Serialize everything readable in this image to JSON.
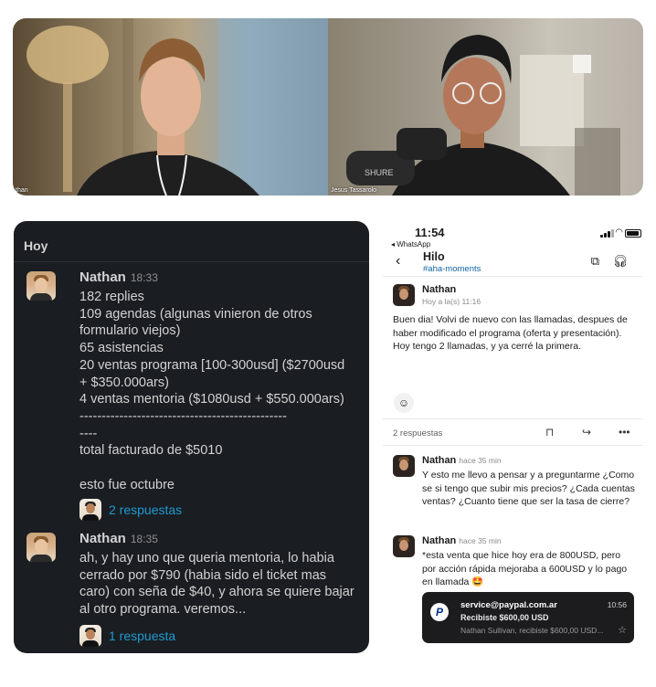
{
  "video": {
    "left_name": "than",
    "right_name": "Jesus Tassarolo"
  },
  "slack": {
    "day": "Hoy",
    "messages": [
      {
        "author": "Nathan",
        "time": "18:33",
        "lines": [
          "182 replies",
          "109 agendas (algunas vinieron de otros",
          "formulario viejos)",
          "65 asistencias",
          "20 ventas programa [100-300usd] ($2700usd",
          "+ $350.000ars)",
          "4 ventas mentoria ($1080usd + $550.000ars)",
          "-----------------------------------------------",
          "----",
          "total facturado de $5010",
          "",
          "esto fue octubre"
        ],
        "replies": "2 respuestas"
      },
      {
        "author": "Nathan",
        "time": "18:35",
        "lines": [
          "ah, y hay uno que queria mentoria, lo habia",
          "cerrado por $790 (habia sido el ticket mas",
          "caro) con seña de $40, y ahora se quiere bajar",
          "al otro programa. veremos..."
        ],
        "replies": "1 respuesta"
      }
    ]
  },
  "phone": {
    "clock": "11:54",
    "back_app": "◂ WhatsApp",
    "title": "Hilo",
    "channel": "#aha-moments",
    "original": {
      "author": "Nathan",
      "time": "Hoy a la(s) 11:16",
      "text": "Buen dia! Volvi de nuevo con las llamadas, despues de haber modificado el programa (oferta y presentación). Hoy tengo 2 llamadas, y ya cerré la primera."
    },
    "reply_count": "2 respuestas",
    "replies": [
      {
        "author": "Nathan",
        "time": "hace 35 min",
        "text": "Y esto me llevo a pensar y a preguntarme ¿Como se si tengo que subir mis precios? ¿Cada cuentas ventas? ¿Cuanto tiene que ser la tasa de cierre?"
      },
      {
        "author": "Nathan",
        "time": "hace 35 min",
        "text": "*esta venta que hice hoy era de 800USD, pero por acción rápida mejoraba a 600USD y lo pago en llamada 🤩"
      }
    ],
    "notification": {
      "from": "service@paypal.com.ar",
      "time": "10:56",
      "title": "Recibiste $600,00 USD",
      "subtitle": "Nathan Sullivan, recibiste $600,00 USD..."
    }
  }
}
